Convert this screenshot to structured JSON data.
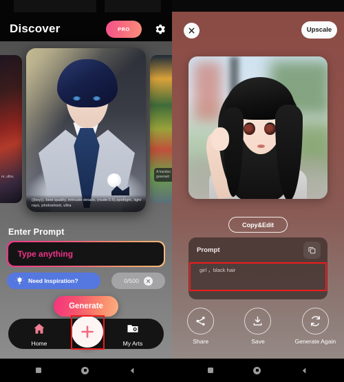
{
  "left": {
    "header": {
      "title": "Discover",
      "pro_badge": "PRO",
      "settings_icon": "gear-icon"
    },
    "carousel": {
      "main_caption": "((boy)), best quality, intricate details, (nude:0.5),spotlight, light rays, photoshoot, ultra",
      "right_caption": "A handso greenwit",
      "left_caption": "re, ultra."
    },
    "prompt_section": {
      "label": "Enter Prompt",
      "input_value": "",
      "input_placeholder": "Type anything",
      "inspiration_label": "Need Inspiration?",
      "inspiration_icon": "lightbulb-icon",
      "counter": "0/500",
      "clear_icon": "close-circle-icon"
    },
    "generate_label": "Generate",
    "tabbar": {
      "items": [
        {
          "label": "Home",
          "icon": "home-icon"
        },
        {
          "label": "My Arts",
          "icon": "photo-folder-icon"
        }
      ],
      "fab_icon": "plus-icon"
    }
  },
  "right": {
    "close_icon": "close-icon",
    "upscale_label": "Upscale",
    "copyedit_label": "Copy&Edit",
    "prompt_card": {
      "title": "Prompt",
      "copy_icon": "copy-icon",
      "value": "girl ，black hair"
    },
    "actions": [
      {
        "label": "Share",
        "icon": "share-icon"
      },
      {
        "label": "Save",
        "icon": "download-icon"
      },
      {
        "label": "Generate Again",
        "icon": "refresh-icon"
      }
    ]
  },
  "system_nav": {
    "icons": [
      "square-icon",
      "circle-icon",
      "back-chevron-icon"
    ]
  },
  "colors": {
    "accent_pink": "#f0338a",
    "accent_orange": "#fbb183",
    "inspiration_blue": "#5578e0",
    "right_panel_red": "#8a4a44",
    "annotation_red": "#ef1b1b"
  }
}
